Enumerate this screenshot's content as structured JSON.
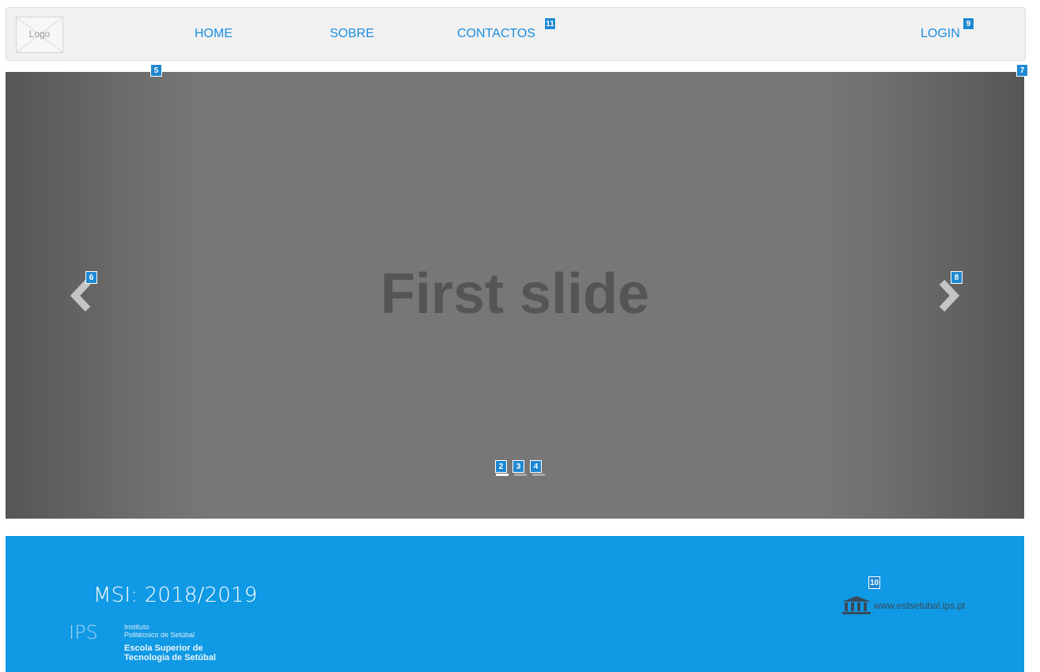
{
  "navbar": {
    "logo_label": "Logo",
    "links": [
      {
        "label": "HOME"
      },
      {
        "label": "SOBRE"
      },
      {
        "label": "CONTACTOS"
      },
      {
        "label": "LOGIN"
      }
    ]
  },
  "carousel": {
    "caption": "First slide",
    "prev_icon": "chevron-left-icon",
    "next_icon": "chevron-right-icon",
    "indicator_count": 3,
    "active_indicator": 1
  },
  "footer": {
    "course": "MSI: 2018/2019",
    "ips_letters": "IPS",
    "ips_lines": [
      "Instituto",
      "Politécnico de Setúbal",
      "Escola Superior de",
      "Tecnologia de Setúbal"
    ],
    "site_icon": "building-icon",
    "site_url": "www.estsetubal.ips.pt"
  },
  "markers": {
    "m1": "11",
    "m2": "9",
    "m3": "5",
    "m4": "7",
    "m5": "6",
    "m6": "8",
    "m7": "2",
    "m8": "3",
    "m9": "4",
    "m10": "10"
  },
  "colors": {
    "accent": "#1a8fe0",
    "footer_bg": "#1099e4",
    "badge": "#1e88d2",
    "carousel_bg": "#777777"
  }
}
